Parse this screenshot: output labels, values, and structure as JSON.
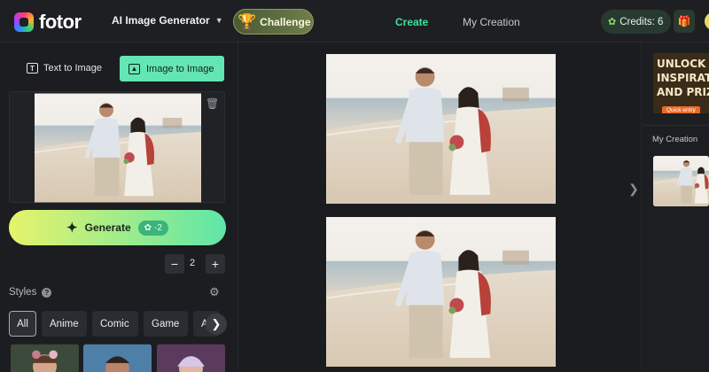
{
  "header": {
    "logo_text": "fotor",
    "generator_menu": "AI Image Generator",
    "challenge_label": "Challenge",
    "nav_create": "Create",
    "nav_my_creation": "My Creation",
    "credits_label": "Credits: 6"
  },
  "sidebar": {
    "mode_text": "Text to Image",
    "mode_image": "Image to Image",
    "generate_label": "Generate",
    "generate_cost": "-2",
    "quantity": "2",
    "styles_label": "Styles",
    "style_chips": [
      "All",
      "Anime",
      "Comic",
      "Game",
      "A"
    ]
  },
  "right_panel": {
    "banner_lines": [
      "UNLOCK C",
      "INSPIRATI",
      "AND PRIZ"
    ],
    "banner_button": "Quick entry",
    "my_creation_label": "My Creation"
  },
  "colors": {
    "accent_green": "#3ee39a",
    "mode_active_bg": "#63e6b3",
    "background": "#1c1d21"
  },
  "icons": {
    "challenge": "trophy-icon",
    "credits": "leaf-icon",
    "gift": "gift-icon",
    "generate": "magic-wand-icon",
    "delete": "trash-icon",
    "styles_settings": "gear-icon",
    "styles_help": "help-icon",
    "chips_next": "chevron-right-icon"
  }
}
